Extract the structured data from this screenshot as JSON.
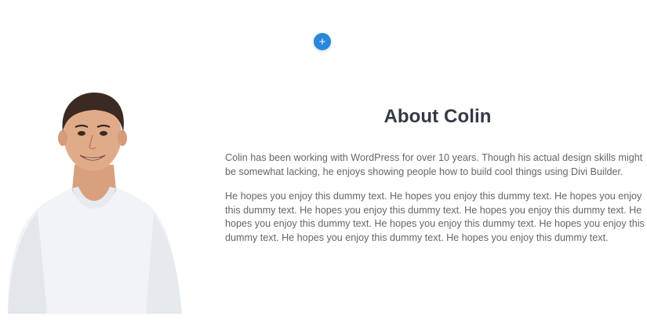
{
  "builder": {
    "add_icon": "plus-icon",
    "add_symbol": "+",
    "accent": "#2b87da"
  },
  "about": {
    "title": "About Colin",
    "paragraph1_lines": [
      "Colin has been working with WordPress for over 10 years. Though his actual design skills might",
      "be somewhat lacking, he enjoys showing people how to build cool things using Divi Builder."
    ],
    "paragraph2_lines": [
      "He hopes you enjoy this dummy text. He hopes you enjoy this dummy text. He hopes you enjoy",
      "this dummy text. He hopes you enjoy this dummy text. He hopes you enjoy this dummy text. He",
      "hopes you enjoy this dummy text. He hopes you enjoy this dummy text. He hopes you enjoy this",
      "dummy text. He hopes you enjoy this dummy text. He hopes you enjoy this dummy text."
    ]
  }
}
